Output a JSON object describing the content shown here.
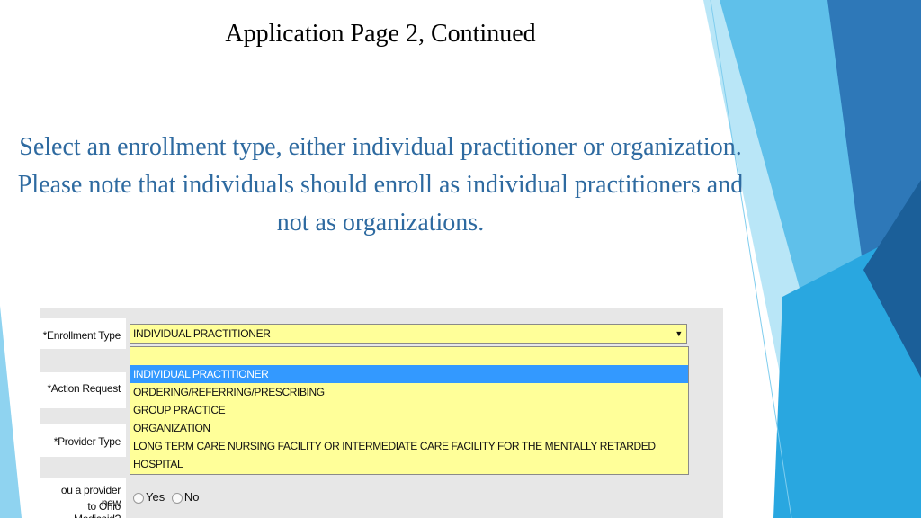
{
  "slide": {
    "title": "Application Page 2, Continued",
    "body": "Select an enrollment type, either individual practitioner or organization.  Please note that individuals should enroll as individual practitioners and not as organizations."
  },
  "form": {
    "enrollment_type_label": "*Enrollment Type",
    "action_request_label": "*Action Request",
    "provider_type_label": "*Provider Type",
    "new_provider_label_line1": "ou a provider new",
    "new_provider_label_line2": "to Ohio Medicaid?",
    "selected_value": "INDIVIDUAL PRACTITIONER",
    "dropdown_arrow": "▼",
    "options": [
      "INDIVIDUAL PRACTITIONER",
      "ORDERING/REFERRING/PRESCRIBING",
      "GROUP PRACTICE",
      "ORGANIZATION",
      "LONG TERM CARE NURSING FACILITY OR INTERMEDIATE CARE FACILITY FOR THE MENTALLY RETARDED",
      "HOSPITAL"
    ],
    "radio_yes": "Yes",
    "radio_no": "No"
  },
  "colors": {
    "title_text": "#000000",
    "body_text": "#2e6aa0",
    "select_bg": "#ffff99",
    "option_highlight": "#3399ff",
    "accent_blue": "#1f77b4"
  }
}
